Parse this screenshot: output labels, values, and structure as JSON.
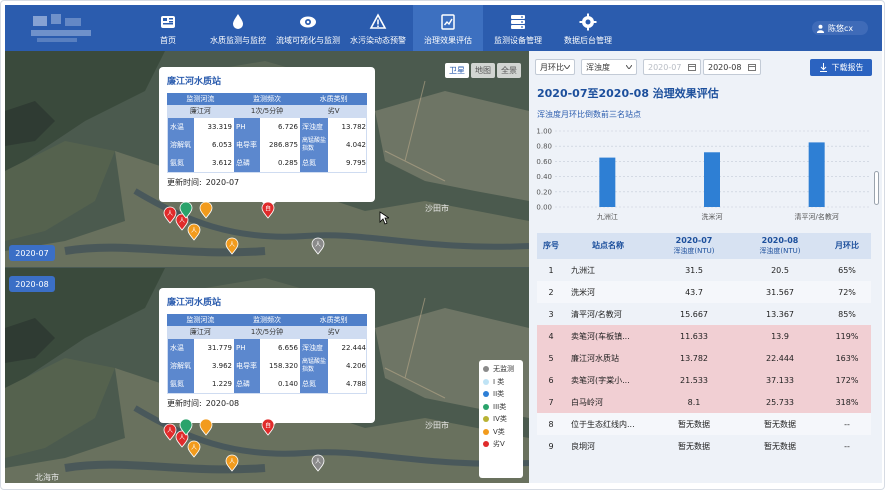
{
  "header": {
    "nav": [
      {
        "label": "首页",
        "icon": "dashboard-icon"
      },
      {
        "label": "水质监测与监控",
        "icon": "water-drop-icon"
      },
      {
        "label": "流域可视化与监测",
        "icon": "eye-icon"
      },
      {
        "label": "水污染动态预警",
        "icon": "alert-icon"
      },
      {
        "label": "治理效果评估",
        "icon": "report-icon",
        "active": true
      },
      {
        "label": "监测设备管理",
        "icon": "device-icon"
      },
      {
        "label": "数据后台管理",
        "icon": "gear-icon"
      }
    ],
    "user": "陈悠cx"
  },
  "map": {
    "tabs": [
      "卫星",
      "地图",
      "全景"
    ],
    "active_tab": "卫星",
    "map_labels": [
      "沙田市",
      "北海市"
    ],
    "panes": [
      {
        "date": "2020-07",
        "popup": {
          "title": "廉江河水质站",
          "head": [
            "监测河流",
            "监测频次",
            "水质类别"
          ],
          "head_values": [
            "廉江河",
            "1次/5分钟",
            "劣V"
          ],
          "rows": [
            [
              {
                "k": "水温",
                "v": "33.319"
              },
              {
                "k": "PH",
                "v": "6.726"
              },
              {
                "k": "浑浊度",
                "v": "13.782"
              }
            ],
            [
              {
                "k": "溶解氧",
                "v": "6.053"
              },
              {
                "k": "电导率",
                "v": "286.875"
              },
              {
                "k": "高锰酸盐指数",
                "v": "4.042"
              }
            ],
            [
              {
                "k": "氨氮",
                "v": "3.612"
              },
              {
                "k": "总磷",
                "v": "0.285"
              },
              {
                "k": "总氮",
                "v": "9.795"
              }
            ]
          ],
          "update_label": "更新时间:",
          "update_value": "2020-07"
        }
      },
      {
        "date": "2020-08",
        "popup": {
          "title": "廉江河水质站",
          "head": [
            "监测河流",
            "监测频次",
            "水质类别"
          ],
          "head_values": [
            "廉江河",
            "1次/5分钟",
            "劣V"
          ],
          "rows": [
            [
              {
                "k": "水温",
                "v": "31.779"
              },
              {
                "k": "PH",
                "v": "6.656"
              },
              {
                "k": "浑浊度",
                "v": "22.444"
              }
            ],
            [
              {
                "k": "溶解氧",
                "v": "3.962"
              },
              {
                "k": "电导率",
                "v": "158.320"
              },
              {
                "k": "高锰酸盐指数",
                "v": "4.206"
              }
            ],
            [
              {
                "k": "氨氮",
                "v": "1.229"
              },
              {
                "k": "总磷",
                "v": "0.140"
              },
              {
                "k": "总氮",
                "v": "4.788"
              }
            ]
          ],
          "update_label": "更新时间:",
          "update_value": "2020-08"
        }
      }
    ],
    "marker_labels": {
      "human": "人",
      "self": "自"
    },
    "legend": [
      {
        "label": "无监测",
        "color": "#8a8a8a"
      },
      {
        "label": "I 类",
        "color": "#bfe3f5"
      },
      {
        "label": "II类",
        "color": "#2d7fd6"
      },
      {
        "label": "III类",
        "color": "#2aa36b"
      },
      {
        "label": "IV类",
        "color": "#b8b234"
      },
      {
        "label": "V类",
        "color": "#f29b1d"
      },
      {
        "label": "劣V",
        "color": "#e02b2b"
      }
    ]
  },
  "filters": {
    "compare": "月环比",
    "metric": "浑浊度",
    "start": "2020-07",
    "end": "2020-08",
    "download": "下载报告"
  },
  "panel": {
    "title": "2020-07至2020-08 治理效果评估",
    "chart_title": "浑浊度月环比倒数前三名站点"
  },
  "chart_data": {
    "type": "bar",
    "categories": [
      "九洲江",
      "洗米河",
      "清平河/名教河"
    ],
    "values": [
      0.65,
      0.72,
      0.85
    ],
    "ylim": [
      0,
      1.0
    ],
    "yticks": [
      "0.00",
      "0.20",
      "0.40",
      "0.60",
      "0.80",
      "1.00"
    ],
    "color": "#2e7fd4",
    "grid": true
  },
  "table": {
    "headers": {
      "idx": "序号",
      "name": "站点名称",
      "c1": "2020-07",
      "c1_sub": "浑浊度(NTU)",
      "c2": "2020-08",
      "c2_sub": "浑浊度(NTU)",
      "ratio": "月环比"
    },
    "rows": [
      {
        "idx": "1",
        "name": "九洲江",
        "v1": "31.5",
        "v2": "20.5",
        "ratio": "65%",
        "hl": false
      },
      {
        "idx": "2",
        "name": "洗米河",
        "v1": "43.7",
        "v2": "31.567",
        "ratio": "72%",
        "hl": false
      },
      {
        "idx": "3",
        "name": "清平河/名教河",
        "v1": "15.667",
        "v2": "13.367",
        "ratio": "85%",
        "hl": false
      },
      {
        "idx": "4",
        "name": "卖笔河(车板镇...",
        "v1": "11.633",
        "v2": "13.9",
        "ratio": "119%",
        "hl": true
      },
      {
        "idx": "5",
        "name": "廉江河水质站",
        "v1": "13.782",
        "v2": "22.444",
        "ratio": "163%",
        "hl": true
      },
      {
        "idx": "6",
        "name": "卖笔河(字棠小...",
        "v1": "21.533",
        "v2": "37.133",
        "ratio": "172%",
        "hl": true
      },
      {
        "idx": "7",
        "name": "白马岭河",
        "v1": "8.1",
        "v2": "25.733",
        "ratio": "318%",
        "hl": true
      },
      {
        "idx": "8",
        "name": "位于生态红线内...",
        "v1": "暂无数据",
        "v2": "暂无数据",
        "ratio": "--",
        "hl": false
      },
      {
        "idx": "9",
        "name": "良垌河",
        "v1": "暂无数据",
        "v2": "暂无数据",
        "ratio": "--",
        "hl": false
      }
    ]
  }
}
